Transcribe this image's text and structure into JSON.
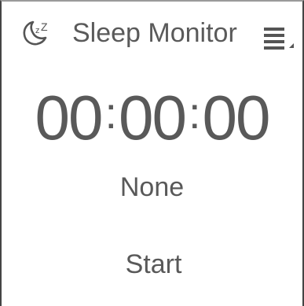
{
  "header": {
    "icon": "moon-sleep-icon",
    "title": "Sleep Monitor",
    "menu_icon": "menu-icon"
  },
  "timer": {
    "hours": "00",
    "separator1": ":",
    "minutes": "00",
    "separator2": ":",
    "seconds": "00"
  },
  "status": {
    "state": "None"
  },
  "controls": {
    "start_label": "Start"
  },
  "colors": {
    "text": "#595959",
    "border": "#444444",
    "background": "#ffffff"
  }
}
